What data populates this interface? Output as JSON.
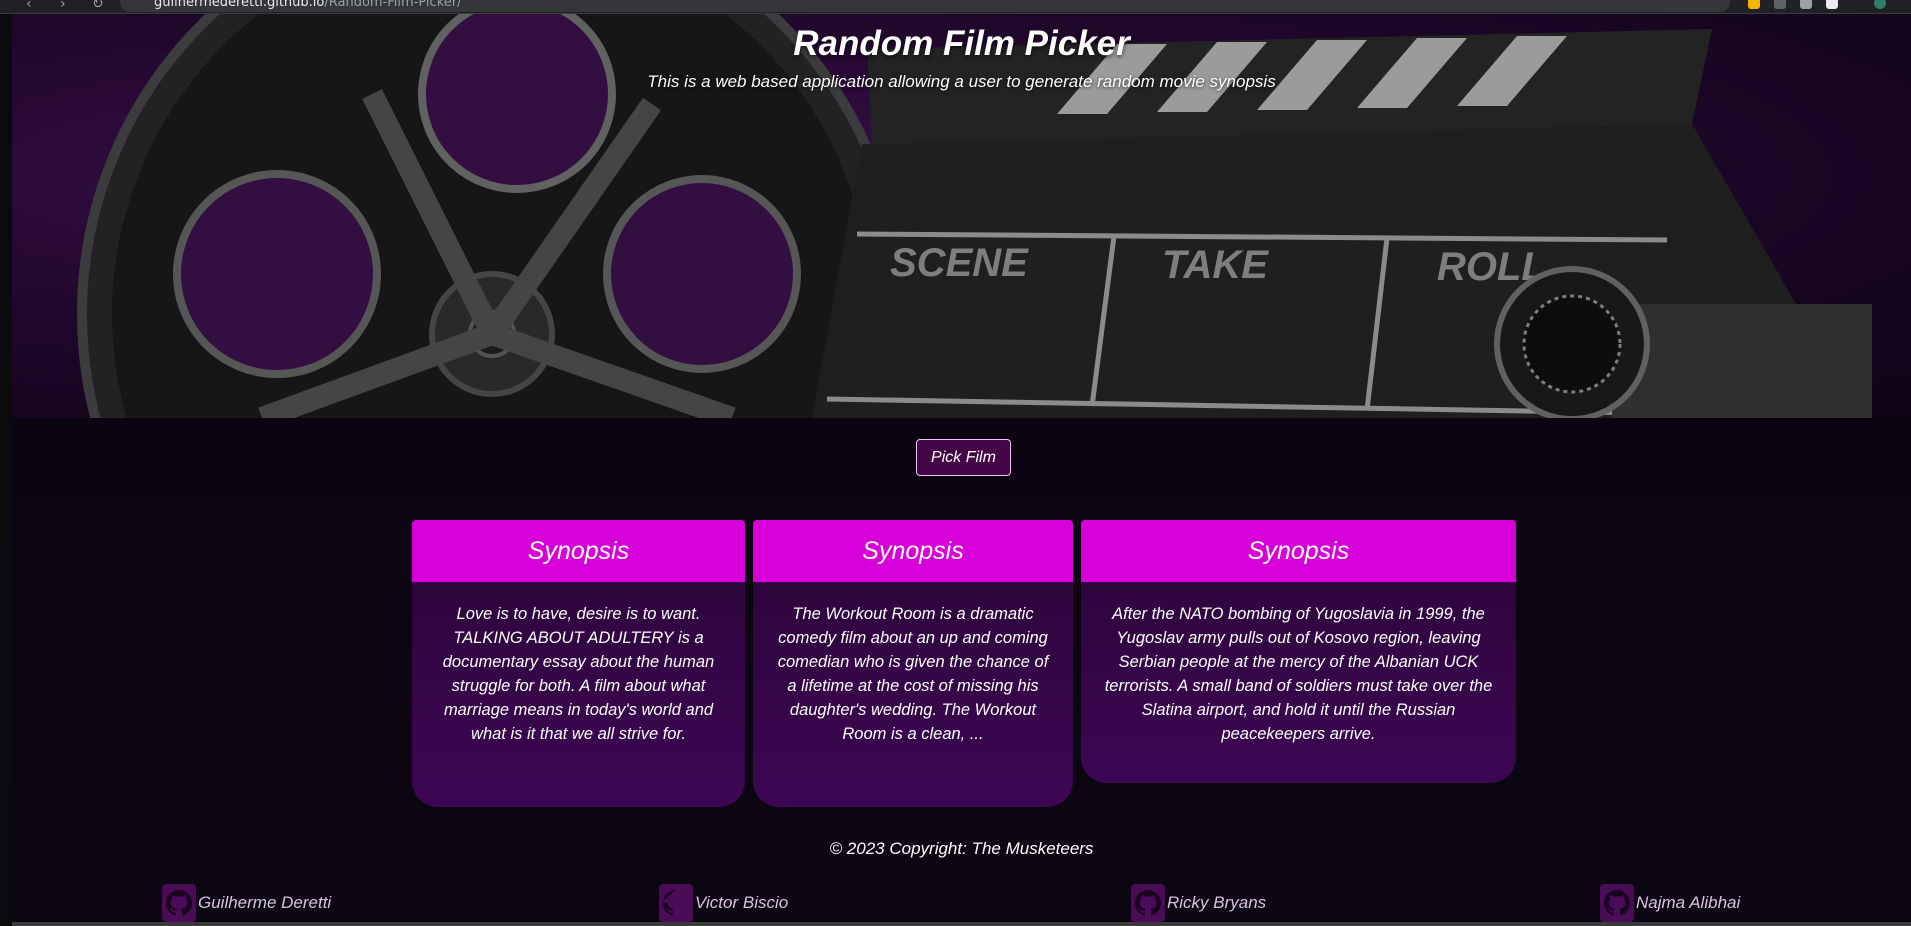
{
  "browser": {
    "url_host": "guilhermederetti.github.io",
    "url_path": "/Random-Film-Picker/"
  },
  "hero": {
    "title": "Random Film Picker",
    "subtitle": "This is a web based application allowing a user to generate random movie synopsis",
    "slate_labels": [
      "SCENE",
      "TAKE",
      "ROLL"
    ]
  },
  "pick_button": {
    "label": "Pick Film"
  },
  "cards": [
    {
      "heading": "Synopsis",
      "text": "Love is to have, desire is to want. TALKING ABOUT ADULTERY is a documentary essay about the human struggle for both. A film about what marriage means in today's world and what is it that we all strive for."
    },
    {
      "heading": "Synopsis",
      "text": "The Workout Room is a dramatic comedy film about an up and coming comedian who is given the chance of a lifetime at the cost of missing his daughter's wedding. The Workout Room is a clean, ..."
    },
    {
      "heading": "Synopsis",
      "text": "After the NATO bombing of Yugoslavia in 1999, the Yugoslav army pulls out of Kosovo region, leaving Serbian people at the mercy of the Albanian UCK terrorists. A small band of soldiers must take over the Slatina airport, and hold it until the Russian peacekeepers arrive."
    }
  ],
  "footer": {
    "copyright": "© 2023 Copyright: The Musketeers",
    "authors": [
      {
        "name": "Guilherme Deretti",
        "icon": "github-icon"
      },
      {
        "name": "Victor Biscio",
        "icon": "github-icon"
      },
      {
        "name": "Ricky Bryans",
        "icon": "github-icon"
      },
      {
        "name": "Najma Alibhai",
        "icon": "github-icon"
      }
    ]
  },
  "colors": {
    "accent": "#d800d8",
    "card_bg": "#3d0654",
    "button_bg": "#450648",
    "page_bg": "#0a0310"
  }
}
